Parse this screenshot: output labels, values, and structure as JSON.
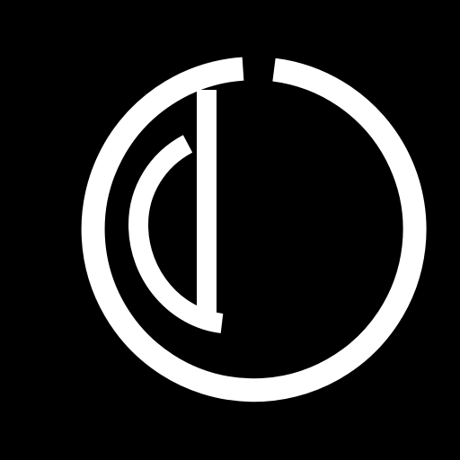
{
  "icon": "abstract-circle-logo-icon",
  "colors": {
    "background": "#000000",
    "foreground": "#FFFFFF"
  }
}
